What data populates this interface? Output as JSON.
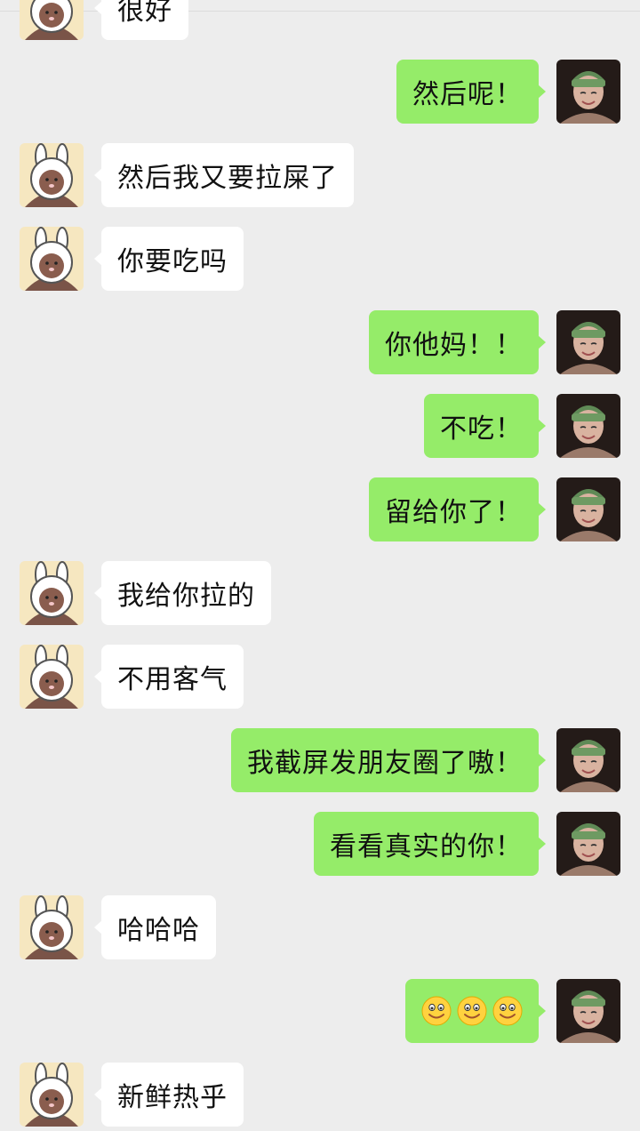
{
  "chat": {
    "messages": [
      {
        "side": "left",
        "text": "很好"
      },
      {
        "side": "right",
        "text": "然后呢！"
      },
      {
        "side": "left",
        "text": "然后我又要拉屎了"
      },
      {
        "side": "left",
        "text": "你要吃吗"
      },
      {
        "side": "right",
        "text": "你他妈！！"
      },
      {
        "side": "right",
        "text": "不吃！"
      },
      {
        "side": "right",
        "text": "留给你了！"
      },
      {
        "side": "left",
        "text": "我给你拉的"
      },
      {
        "side": "left",
        "text": "不用客气"
      },
      {
        "side": "right",
        "text": "我截屏发朋友圈了嗷！"
      },
      {
        "side": "right",
        "text": "看看真实的你！"
      },
      {
        "side": "left",
        "text": "哈哈哈"
      },
      {
        "side": "right",
        "emoji": [
          "smile-emoji",
          "smile-emoji",
          "smile-emoji"
        ]
      },
      {
        "side": "left",
        "text": "新鲜热乎"
      }
    ]
  },
  "colors": {
    "background": "#ededed",
    "incoming_bubble": "#ffffff",
    "outgoing_bubble": "#95ec69",
    "text": "#111111"
  },
  "icons": {
    "incoming_avatar": "bunny-hood-bear-avatar",
    "outgoing_avatar": "green-beanie-person-avatar"
  }
}
